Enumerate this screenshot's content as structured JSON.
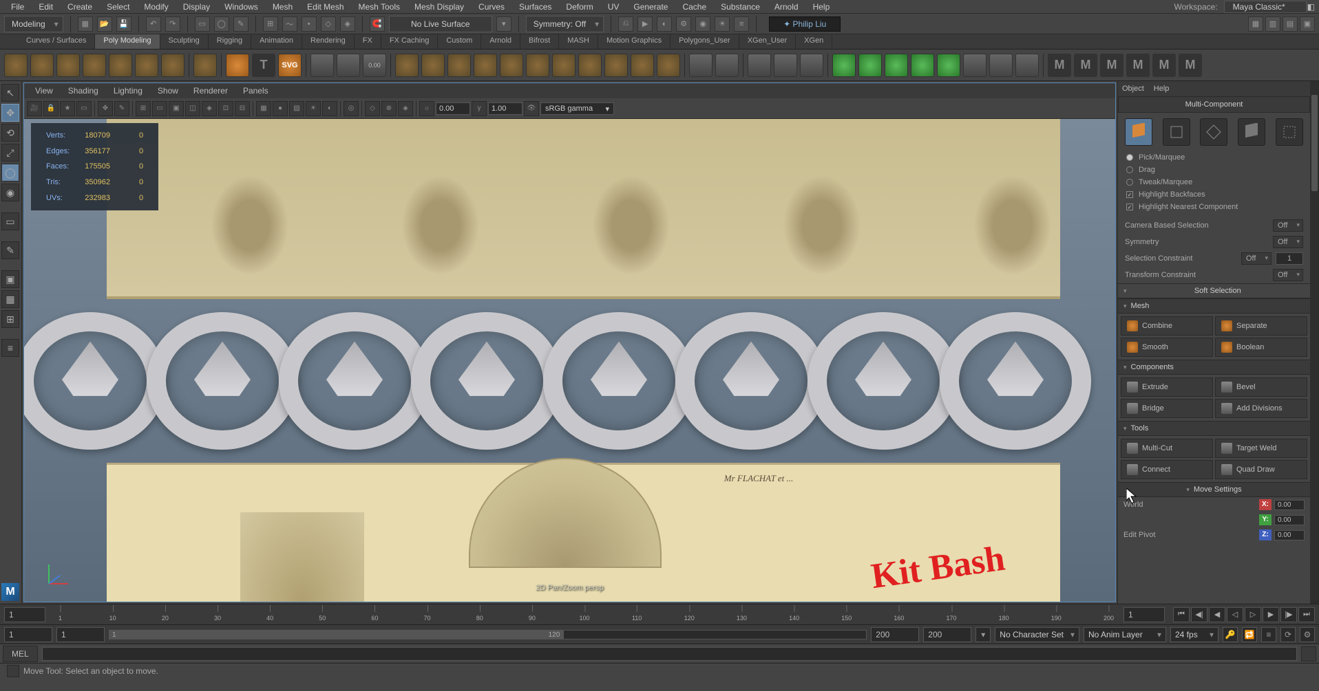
{
  "menubar": {
    "items": [
      "File",
      "Edit",
      "Create",
      "Select",
      "Modify",
      "Display",
      "Windows",
      "Mesh",
      "Edit Mesh",
      "Mesh Tools",
      "Mesh Display",
      "Curves",
      "Surfaces",
      "Deform",
      "UV",
      "Generate",
      "Cache",
      "Substance",
      "Arnold",
      "Help"
    ],
    "workspace_label": "Workspace:",
    "workspace_value": "Maya Classic*"
  },
  "status": {
    "mode": "Modeling",
    "live_surface": "No Live Surface",
    "symmetry": "Symmetry: Off",
    "user": "✦ Philip Liu"
  },
  "shelf_tabs": [
    "Curves / Surfaces",
    "Poly Modeling",
    "Sculpting",
    "Rigging",
    "Animation",
    "Rendering",
    "FX",
    "FX Caching",
    "Custom",
    "Arnold",
    "Bifrost",
    "MASH",
    "Motion Graphics",
    "Polygons_User",
    "XGen_User",
    "XGen"
  ],
  "shelf_active": 1,
  "view_menus": [
    "View",
    "Shading",
    "Lighting",
    "Show",
    "Renderer",
    "Panels"
  ],
  "view_toolbar": {
    "num1": "0.00",
    "num2": "1.00",
    "gamma": "sRGB gamma"
  },
  "stats": {
    "rows": [
      {
        "label": "Verts:",
        "value": "180709",
        "sel": "0"
      },
      {
        "label": "Edges:",
        "value": "356177",
        "sel": "0"
      },
      {
        "label": "Faces:",
        "value": "175505",
        "sel": "0"
      },
      {
        "label": "Tris:",
        "value": "350962",
        "sel": "0"
      },
      {
        "label": "UVs:",
        "value": "232983",
        "sel": "0"
      }
    ]
  },
  "viewport": {
    "hud": "2D Pan/Zoom   persp",
    "handwriting": "Kit Bash",
    "caption": "Mr FLACHAT et ..."
  },
  "right": {
    "menus": [
      "Object",
      "Help"
    ],
    "multi_component": "Multi-Component",
    "sel_modes": {
      "pick": "Pick/Marquee",
      "drag": "Drag",
      "tweak": "Tweak/Marquee",
      "backfaces": "Highlight Backfaces",
      "nearest": "Highlight Nearest Component"
    },
    "dropdowns": {
      "camera_sel_label": "Camera Based Selection",
      "camera_sel_val": "Off",
      "symmetry_label": "Symmetry",
      "symmetry_val": "Off",
      "sel_constraint_label": "Selection Constraint",
      "sel_constraint_val": "Off",
      "sel_constraint_num": "1",
      "xform_constraint_label": "Transform Constraint",
      "xform_constraint_val": "Off"
    },
    "sections": {
      "soft": "Soft Selection",
      "mesh": "Mesh",
      "components": "Components",
      "tools": "Tools",
      "move_settings": "Move Settings"
    },
    "mesh_btns": {
      "combine": "Combine",
      "separate": "Separate",
      "smooth": "Smooth",
      "boolean": "Boolean"
    },
    "comp_btns": {
      "extrude": "Extrude",
      "bevel": "Bevel",
      "bridge": "Bridge",
      "adddiv": "Add Divisions"
    },
    "tool_btns": {
      "multicut": "Multi-Cut",
      "targetweld": "Target Weld",
      "connect": "Connect",
      "quaddraw": "Quad Draw"
    },
    "world": "World",
    "edit_pivot": "Edit Pivot",
    "axis_x": "X:",
    "axis_y": "Y:",
    "axis_z": "Z:",
    "axis_val": "0.00"
  },
  "timeline": {
    "current": "1",
    "current_right": "1",
    "ticks": [
      "1",
      "10",
      "20",
      "30",
      "40",
      "50",
      "60",
      "70",
      "80",
      "90",
      "100",
      "110",
      "120",
      "130",
      "140",
      "150",
      "160",
      "170",
      "180",
      "190",
      "200"
    ]
  },
  "range": {
    "start": "1",
    "start_in": "1",
    "mid_a": "120",
    "end_out": "200",
    "end": "200",
    "char_set": "No Character Set",
    "anim_layer": "No Anim Layer",
    "fps": "24 fps"
  },
  "cmd": {
    "label": "MEL"
  },
  "help_line": "Move Tool: Select an object to move."
}
